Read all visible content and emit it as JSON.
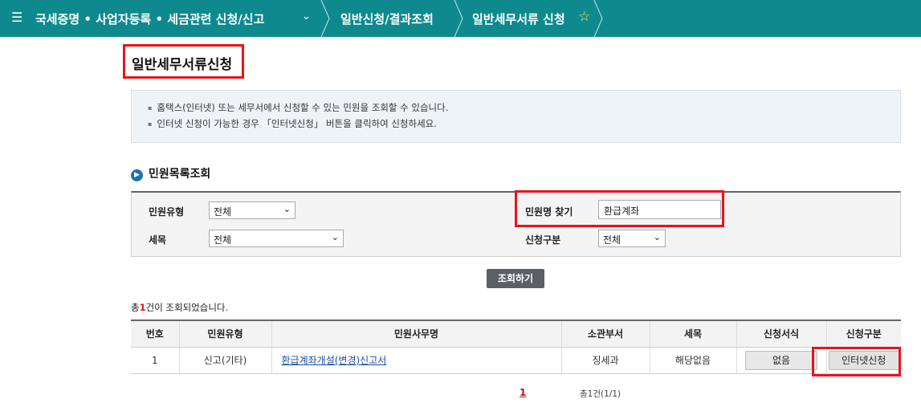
{
  "nav": {
    "menu_glyph": "☰",
    "crumb1": "국세증명 • 사업자등록 • 세금관련 신청/신고",
    "crumb1_toggle": "⌄",
    "crumb2": "일반신청/결과조회",
    "crumb3": "일반세무서류 신청",
    "favorite_glyph": "☆",
    "bar_color": "#0e8a8e"
  },
  "page": {
    "title": "일반세무서류신청"
  },
  "info": {
    "line1": "홈택스(인터넷) 또는 세무서에서 신청할 수 있는 민원을 조회할 수 있습니다.",
    "line2": "인터넷 신청이 가능한 경우 「인터넷신청」 버튼을 클릭하여 신청하세요."
  },
  "section": {
    "title": "민원목록조회"
  },
  "search": {
    "type_label": "민원유형",
    "type_value": "전체",
    "tax_label": "세목",
    "tax_value": "전체",
    "name_label": "민원명 찾기",
    "name_value": "환급계좌",
    "apply_label": "신청구분",
    "apply_value": "전체",
    "button": "조회하기"
  },
  "results": {
    "count_prefix": "총",
    "count_num": "1",
    "count_suffix": "건이 조회되었습니다.",
    "headers": [
      "번호",
      "민원유형",
      "민원사무명",
      "소관부서",
      "세목",
      "신청서식",
      "신청구분"
    ],
    "rows": [
      {
        "no": "1",
        "type": "신고(기타)",
        "name": "환급계좌개설(변경)신고서",
        "dept": "징세과",
        "tax": "해당없음",
        "form_btn": "없음",
        "apply_btn": "인터넷신청"
      }
    ]
  },
  "pagination": {
    "current": "1",
    "total": "총1건(1/1)"
  },
  "highlight_color": "#e8141c"
}
